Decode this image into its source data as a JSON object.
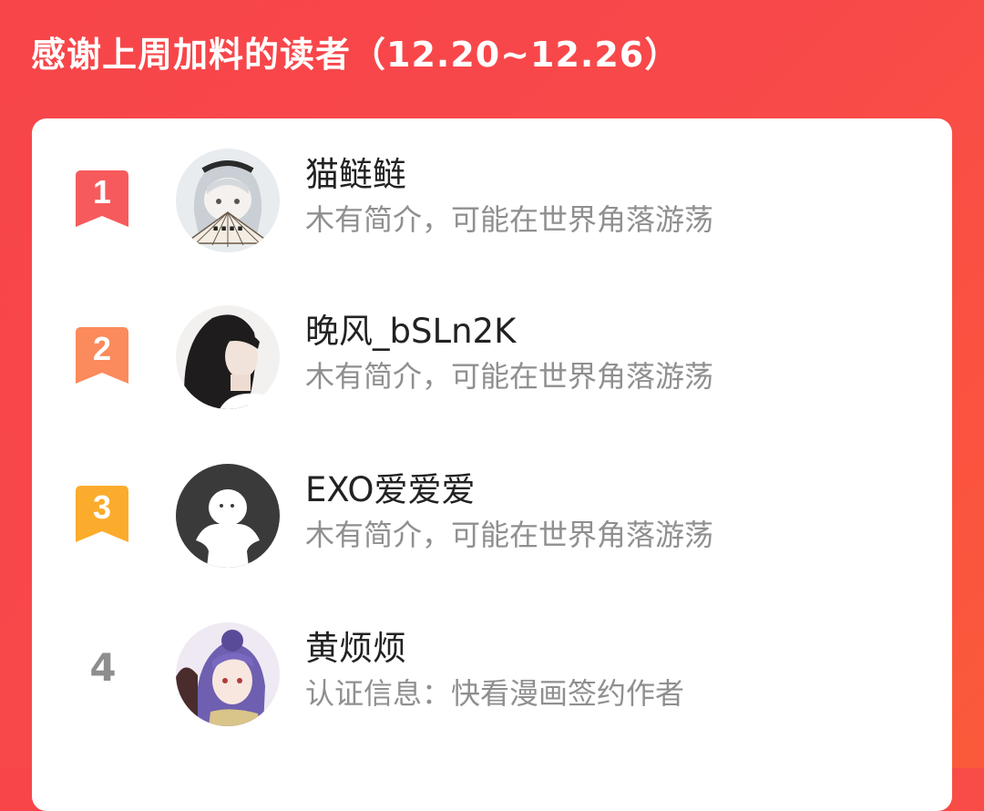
{
  "header": {
    "title": "感谢上周加料的读者（12.20~12.26）"
  },
  "colors": {
    "background": "#f7454a",
    "rank1": "#f75a5c",
    "rank2": "#fb8a5c",
    "rank3": "#fbac2c",
    "rank_plain": "#8e8e8e"
  },
  "readers": [
    {
      "rank": "1",
      "name": "猫鲢鲢",
      "bio": "木有简介，可能在世界角落游荡",
      "avatar": "anime-girl-fan-avatar"
    },
    {
      "rank": "2",
      "name": "晚风_bSLn2K",
      "bio": "木有简介，可能在世界角落游荡",
      "avatar": "girl-photo-avatar"
    },
    {
      "rank": "3",
      "name": "EXO爱爱爱",
      "bio": "木有简介，可能在世界角落游荡",
      "avatar": "default-user-avatar"
    },
    {
      "rank": "4",
      "name": "黄烦烦",
      "bio": "认证信息：快看漫画签约作者",
      "avatar": "anime-character-avatar"
    }
  ]
}
